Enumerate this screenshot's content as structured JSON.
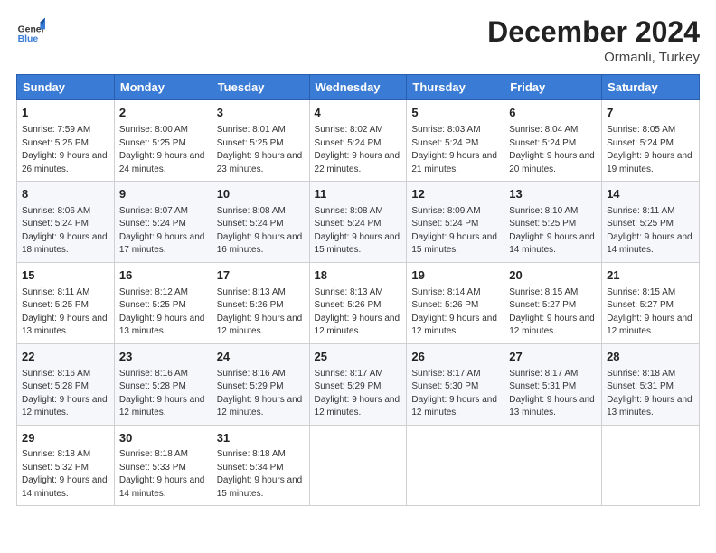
{
  "logo": {
    "general": "General",
    "blue": "Blue"
  },
  "header": {
    "title": "December 2024",
    "subtitle": "Ormanli, Turkey"
  },
  "weekdays": [
    "Sunday",
    "Monday",
    "Tuesday",
    "Wednesday",
    "Thursday",
    "Friday",
    "Saturday"
  ],
  "weeks": [
    [
      {
        "day": "1",
        "sunrise": "Sunrise: 7:59 AM",
        "sunset": "Sunset: 5:25 PM",
        "daylight": "Daylight: 9 hours and 26 minutes."
      },
      {
        "day": "2",
        "sunrise": "Sunrise: 8:00 AM",
        "sunset": "Sunset: 5:25 PM",
        "daylight": "Daylight: 9 hours and 24 minutes."
      },
      {
        "day": "3",
        "sunrise": "Sunrise: 8:01 AM",
        "sunset": "Sunset: 5:25 PM",
        "daylight": "Daylight: 9 hours and 23 minutes."
      },
      {
        "day": "4",
        "sunrise": "Sunrise: 8:02 AM",
        "sunset": "Sunset: 5:24 PM",
        "daylight": "Daylight: 9 hours and 22 minutes."
      },
      {
        "day": "5",
        "sunrise": "Sunrise: 8:03 AM",
        "sunset": "Sunset: 5:24 PM",
        "daylight": "Daylight: 9 hours and 21 minutes."
      },
      {
        "day": "6",
        "sunrise": "Sunrise: 8:04 AM",
        "sunset": "Sunset: 5:24 PM",
        "daylight": "Daylight: 9 hours and 20 minutes."
      },
      {
        "day": "7",
        "sunrise": "Sunrise: 8:05 AM",
        "sunset": "Sunset: 5:24 PM",
        "daylight": "Daylight: 9 hours and 19 minutes."
      }
    ],
    [
      {
        "day": "8",
        "sunrise": "Sunrise: 8:06 AM",
        "sunset": "Sunset: 5:24 PM",
        "daylight": "Daylight: 9 hours and 18 minutes."
      },
      {
        "day": "9",
        "sunrise": "Sunrise: 8:07 AM",
        "sunset": "Sunset: 5:24 PM",
        "daylight": "Daylight: 9 hours and 17 minutes."
      },
      {
        "day": "10",
        "sunrise": "Sunrise: 8:08 AM",
        "sunset": "Sunset: 5:24 PM",
        "daylight": "Daylight: 9 hours and 16 minutes."
      },
      {
        "day": "11",
        "sunrise": "Sunrise: 8:08 AM",
        "sunset": "Sunset: 5:24 PM",
        "daylight": "Daylight: 9 hours and 15 minutes."
      },
      {
        "day": "12",
        "sunrise": "Sunrise: 8:09 AM",
        "sunset": "Sunset: 5:24 PM",
        "daylight": "Daylight: 9 hours and 15 minutes."
      },
      {
        "day": "13",
        "sunrise": "Sunrise: 8:10 AM",
        "sunset": "Sunset: 5:25 PM",
        "daylight": "Daylight: 9 hours and 14 minutes."
      },
      {
        "day": "14",
        "sunrise": "Sunrise: 8:11 AM",
        "sunset": "Sunset: 5:25 PM",
        "daylight": "Daylight: 9 hours and 14 minutes."
      }
    ],
    [
      {
        "day": "15",
        "sunrise": "Sunrise: 8:11 AM",
        "sunset": "Sunset: 5:25 PM",
        "daylight": "Daylight: 9 hours and 13 minutes."
      },
      {
        "day": "16",
        "sunrise": "Sunrise: 8:12 AM",
        "sunset": "Sunset: 5:25 PM",
        "daylight": "Daylight: 9 hours and 13 minutes."
      },
      {
        "day": "17",
        "sunrise": "Sunrise: 8:13 AM",
        "sunset": "Sunset: 5:26 PM",
        "daylight": "Daylight: 9 hours and 12 minutes."
      },
      {
        "day": "18",
        "sunrise": "Sunrise: 8:13 AM",
        "sunset": "Sunset: 5:26 PM",
        "daylight": "Daylight: 9 hours and 12 minutes."
      },
      {
        "day": "19",
        "sunrise": "Sunrise: 8:14 AM",
        "sunset": "Sunset: 5:26 PM",
        "daylight": "Daylight: 9 hours and 12 minutes."
      },
      {
        "day": "20",
        "sunrise": "Sunrise: 8:15 AM",
        "sunset": "Sunset: 5:27 PM",
        "daylight": "Daylight: 9 hours and 12 minutes."
      },
      {
        "day": "21",
        "sunrise": "Sunrise: 8:15 AM",
        "sunset": "Sunset: 5:27 PM",
        "daylight": "Daylight: 9 hours and 12 minutes."
      }
    ],
    [
      {
        "day": "22",
        "sunrise": "Sunrise: 8:16 AM",
        "sunset": "Sunset: 5:28 PM",
        "daylight": "Daylight: 9 hours and 12 minutes."
      },
      {
        "day": "23",
        "sunrise": "Sunrise: 8:16 AM",
        "sunset": "Sunset: 5:28 PM",
        "daylight": "Daylight: 9 hours and 12 minutes."
      },
      {
        "day": "24",
        "sunrise": "Sunrise: 8:16 AM",
        "sunset": "Sunset: 5:29 PM",
        "daylight": "Daylight: 9 hours and 12 minutes."
      },
      {
        "day": "25",
        "sunrise": "Sunrise: 8:17 AM",
        "sunset": "Sunset: 5:29 PM",
        "daylight": "Daylight: 9 hours and 12 minutes."
      },
      {
        "day": "26",
        "sunrise": "Sunrise: 8:17 AM",
        "sunset": "Sunset: 5:30 PM",
        "daylight": "Daylight: 9 hours and 12 minutes."
      },
      {
        "day": "27",
        "sunrise": "Sunrise: 8:17 AM",
        "sunset": "Sunset: 5:31 PM",
        "daylight": "Daylight: 9 hours and 13 minutes."
      },
      {
        "day": "28",
        "sunrise": "Sunrise: 8:18 AM",
        "sunset": "Sunset: 5:31 PM",
        "daylight": "Daylight: 9 hours and 13 minutes."
      }
    ],
    [
      {
        "day": "29",
        "sunrise": "Sunrise: 8:18 AM",
        "sunset": "Sunset: 5:32 PM",
        "daylight": "Daylight: 9 hours and 14 minutes."
      },
      {
        "day": "30",
        "sunrise": "Sunrise: 8:18 AM",
        "sunset": "Sunset: 5:33 PM",
        "daylight": "Daylight: 9 hours and 14 minutes."
      },
      {
        "day": "31",
        "sunrise": "Sunrise: 8:18 AM",
        "sunset": "Sunset: 5:34 PM",
        "daylight": "Daylight: 9 hours and 15 minutes."
      },
      null,
      null,
      null,
      null
    ]
  ]
}
